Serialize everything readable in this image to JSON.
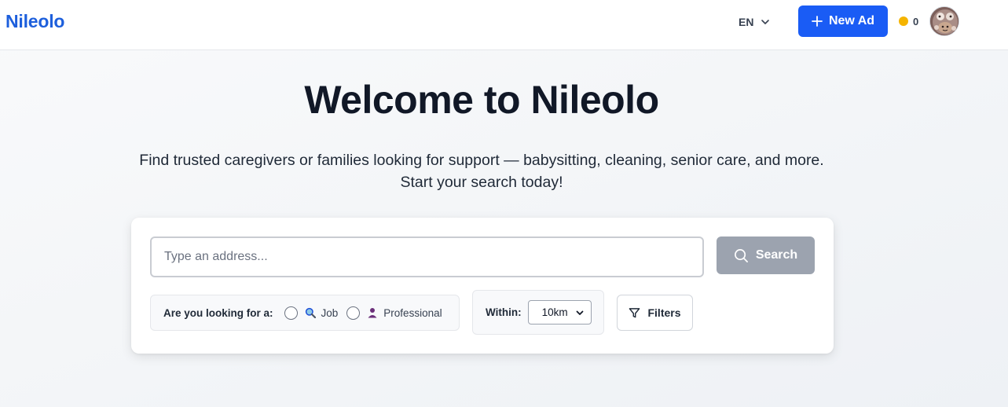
{
  "header": {
    "logo": "Nileolo",
    "language": "EN",
    "new_ad_label": "New Ad",
    "coins": "0"
  },
  "hero": {
    "title": "Welcome to Nileolo",
    "subtitle_line1": "Find trusted caregivers or families looking for support — babysitting, cleaning, senior care, and more.",
    "subtitle_line2": "Start your search today!"
  },
  "search": {
    "placeholder": "Type an address...",
    "value": "",
    "button_label": "Search",
    "looking_for_label": "Are you looking for a:",
    "options": [
      {
        "label": "Job",
        "icon": "magnifier-emoji-icon",
        "selected": false
      },
      {
        "label": "Professional",
        "icon": "person-emoji-icon",
        "selected": false
      }
    ],
    "within_label": "Within:",
    "within_value": "10km",
    "filters_label": "Filters"
  },
  "colors": {
    "brand": "#1d5fdc",
    "primary_button": "#1a5cf5",
    "search_button_disabled": "#9ca3af",
    "coin": "#f5b400"
  }
}
